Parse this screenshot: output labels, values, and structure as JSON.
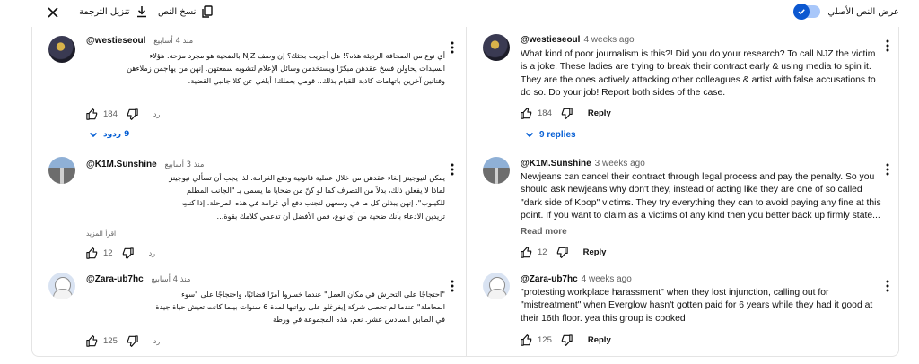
{
  "toolbar": {
    "close_icon": "close-icon",
    "download_label": "تنزيل الترجمة",
    "download_icon": "download-icon",
    "copy_label": "نسخ النص",
    "copy_icon": "copy-icon",
    "toggle_label": "عرض النص الأصلي",
    "toggle_on": true
  },
  "colors": {
    "accent": "#065fd4",
    "toggle": "#0b57d0"
  },
  "left_panel": {
    "comments": [
      {
        "author": "@westieseoul",
        "time": "منذ 4 أسابيع",
        "lines": [
          "أي نوع من الصحافة الرديئة هذه؟! هل أجريت بحثك؟ إن وصف NJZ بالضحية هو مجرد مزحة. هؤلاء",
          "السيدات يحاولن فسخ عقدهن مبكرًا ويستخدمن وسائل الإعلام لتشويه سمعتهن. إنهن من يهاجمن زملاءهن",
          "وفنانين آخرين باتهامات كاذبة للقيام بذلك.. قومي بعملك! أبلغي عن كلا جانبي القضية."
        ],
        "likes": "184",
        "reply_label": "رد",
        "replies_label": "9 ردود"
      },
      {
        "author": "@K1M.Sunshine",
        "time": "منذ 3 أسابيع",
        "lines": [
          "يمكن لنيوجينز إلغاء عقدهن من خلال عملية قانونية ودفع الغرامة. لذا يجب أن تسألي نيوجينز",
          "لماذا لا يفعلن ذلك، بدلاً من التصرف كما لو كنّ من ضحايا ما يسمى بـ \"الجانب المظلم",
          "للكيبوب\". إنهن يبذلن كل ما في وسعهن لتجنب دفع أي غرامة في هذه المرحلة. إذا كنتِ",
          "تريدين الادعاء بأنك ضحية من أي نوع، فمن الأفضل أن تدعمي كلامك بقوة..."
        ],
        "read_more": "اقرأ المزيد",
        "likes": "12",
        "reply_label": "رد"
      },
      {
        "author": "@Zara-ub7hc",
        "time": "منذ 4 أسابيع",
        "lines": [
          "\"احتجاجًا على التحرش في مكان العمل\" عندما خسروا أمرًا قضائيًا، واحتجاجًا على \"سوء",
          "المعاملة\" عندما لم تحصل شركة إيفرغلو على رواتبها لمدة 6 سنوات بينما كانت تعيش حياة جيدة",
          "في الطابق السادس عشر. نعم، هذه المجموعة في ورطة"
        ],
        "likes": "125",
        "reply_label": "رد"
      }
    ]
  },
  "right_panel": {
    "comments": [
      {
        "author": "@westieseoul",
        "time": "4 weeks ago",
        "lines": [
          "What kind of poor journalism is this?! Did you do your research?  To call NJZ the victim",
          "is a joke. These ladies are trying to break their contract early & using media to spin it.",
          "They are the ones actively attacking other colleagues & artist with false accusations to",
          "do so.  Do your job!  Report both sides of the case."
        ],
        "likes": "184",
        "reply_label": "Reply",
        "replies_label": "9 replies"
      },
      {
        "author": "@K1M.Sunshine",
        "time": "3 weeks ago",
        "lines": [
          "Newjeans can cancel their contract through legal process and pay the penalty. So you",
          "should ask newjeans why don't they, instead of acting like they are one of so called",
          "\"dark side of Kpop\" victims. They try everything they can to avoid paying any fine at this",
          "point. If you want to claim as a victims of any kind then you better back up firmly state..."
        ],
        "read_more": "Read more",
        "likes": "12",
        "reply_label": "Reply"
      },
      {
        "author": "@Zara-ub7hc",
        "time": "4 weeks ago",
        "lines": [
          "\"protesting workplace harassment\" when they lost injunction, calling out for",
          "\"mistreatment\" when Everglow hasn't gotten paid for 6 years while they had it good at",
          "their 16th floor. yea this group is cooked"
        ],
        "likes": "125",
        "reply_label": "Reply"
      }
    ]
  }
}
